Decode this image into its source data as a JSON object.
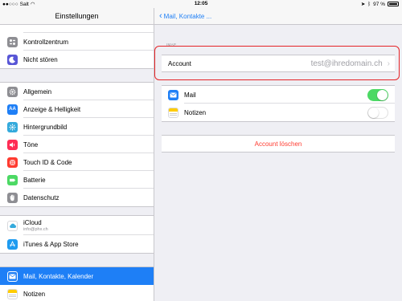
{
  "status_bar": {
    "carrier": "Salt",
    "time": "12:05",
    "battery_percent": "97 %",
    "battery_level": 0.97
  },
  "master": {
    "title": "Einstellungen",
    "groups": [
      {
        "items": [
          {
            "label": "Kontrollzentrum",
            "icon": "control-center-icon",
            "color": "#8e8e93"
          },
          {
            "label": "Nicht stören",
            "icon": "moon-icon",
            "color": "#5856d6"
          }
        ]
      },
      {
        "items": [
          {
            "label": "Allgemein",
            "icon": "gear-icon",
            "color": "#8e8e93"
          },
          {
            "label": "Anzeige & Helligkeit",
            "icon": "text-size-icon",
            "color": "#1e7ff6"
          },
          {
            "label": "Hintergrundbild",
            "icon": "wallpaper-icon",
            "color": "#34aadc"
          },
          {
            "label": "Töne",
            "icon": "speaker-icon",
            "color": "#ff2d55"
          },
          {
            "label": "Touch ID & Code",
            "icon": "fingerprint-icon",
            "color": "#ff3b30"
          },
          {
            "label": "Batterie",
            "icon": "battery-icon",
            "color": "#4cd964"
          },
          {
            "label": "Datenschutz",
            "icon": "hand-icon",
            "color": "#8e8e93"
          }
        ]
      },
      {
        "items": [
          {
            "label": "iCloud",
            "sublabel": "info@phx.ch",
            "icon": "cloud-icon",
            "color": "#ffffff"
          },
          {
            "label": "iTunes & App Store",
            "icon": "app-store-icon",
            "color": "#1e9bf0"
          }
        ]
      },
      {
        "items": [
          {
            "label": "Mail, Kontakte, Kalender",
            "icon": "mail-icon",
            "color": "#1e7ff6",
            "selected": true
          },
          {
            "label": "Notizen",
            "icon": "notes-icon",
            "color": "#ffcc00"
          }
        ]
      }
    ]
  },
  "detail": {
    "back_label": "Mail, Kontakte ...",
    "section_header": "IMAP",
    "account_label": "Account",
    "account_value": "test@ihredomain.ch",
    "services": [
      {
        "label": "Mail",
        "enabled": true,
        "icon": "mail-icon",
        "color": "#1e7ff6"
      },
      {
        "label": "Notizen",
        "enabled": false,
        "icon": "notes-icon",
        "color": "#ffcc00"
      }
    ],
    "delete_label": "Account löschen"
  }
}
